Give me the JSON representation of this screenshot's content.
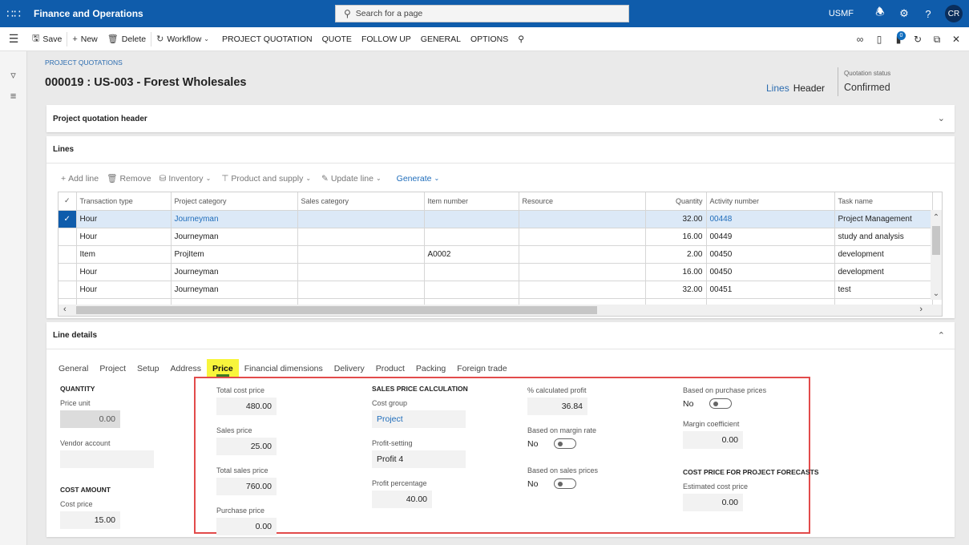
{
  "app": {
    "name": "Finance and Operations",
    "search_placeholder": "Search for a page",
    "company": "USMF",
    "user_initials": "CR",
    "notification_count": "0"
  },
  "actions": {
    "save": "Save",
    "new": "New",
    "delete": "Delete",
    "workflow": "Workflow",
    "menus": [
      "PROJECT QUOTATION",
      "QUOTE",
      "FOLLOW UP",
      "GENERAL",
      "OPTIONS"
    ]
  },
  "page": {
    "breadcrumb": "PROJECT QUOTATIONS",
    "title": "000019 : US-003 - Forest Wholesales",
    "view_lines": "Lines",
    "view_header": "Header",
    "status_label": "Quotation status",
    "status_value": "Confirmed"
  },
  "header_section": {
    "title": "Project quotation header"
  },
  "lines": {
    "title": "Lines",
    "toolbar": {
      "add_line": "Add line",
      "remove": "Remove",
      "inventory": "Inventory",
      "product_supply": "Product and supply",
      "update_line": "Update line",
      "generate": "Generate"
    },
    "columns": [
      "Transaction type",
      "Project category",
      "Sales category",
      "Item number",
      "Resource",
      "Quantity",
      "Activity number",
      "Task name"
    ],
    "rows": [
      {
        "selected": true,
        "transaction_type": "Hour",
        "project_category": "Journeyman",
        "sales_category": "",
        "item_number": "",
        "resource": "",
        "quantity": "32.00",
        "activity_number": "00448",
        "task_name": "Project Management"
      },
      {
        "selected": false,
        "transaction_type": "Hour",
        "project_category": "Journeyman",
        "sales_category": "",
        "item_number": "",
        "resource": "",
        "quantity": "16.00",
        "activity_number": "00449",
        "task_name": "study and analysis"
      },
      {
        "selected": false,
        "transaction_type": "Item",
        "project_category": "ProjItem",
        "sales_category": "",
        "item_number": "A0002",
        "resource": "",
        "quantity": "2.00",
        "activity_number": "00450",
        "task_name": "development"
      },
      {
        "selected": false,
        "transaction_type": "Hour",
        "project_category": "Journeyman",
        "sales_category": "",
        "item_number": "",
        "resource": "",
        "quantity": "16.00",
        "activity_number": "00450",
        "task_name": "development"
      },
      {
        "selected": false,
        "transaction_type": "Hour",
        "project_category": "Journeyman",
        "sales_category": "",
        "item_number": "",
        "resource": "",
        "quantity": "32.00",
        "activity_number": "00451",
        "task_name": "test"
      }
    ]
  },
  "line_details": {
    "title": "Line details",
    "tabs": [
      "General",
      "Project",
      "Setup",
      "Address",
      "Price",
      "Financial dimensions",
      "Delivery",
      "Product",
      "Packing",
      "Foreign trade"
    ],
    "active_tab": "Price",
    "quantity": {
      "section": "QUANTITY",
      "price_unit_label": "Price unit",
      "price_unit": "0.00",
      "vendor_account_label": "Vendor account",
      "vendor_account": ""
    },
    "cost_amount": {
      "section": "COST AMOUNT",
      "cost_price_label": "Cost price",
      "cost_price": "15.00"
    },
    "prices": {
      "total_cost_price_label": "Total cost price",
      "total_cost_price": "480.00",
      "sales_price_label": "Sales price",
      "sales_price": "25.00",
      "total_sales_price_label": "Total sales price",
      "total_sales_price": "760.00",
      "purchase_price_label": "Purchase price",
      "purchase_price": "0.00"
    },
    "sales_price_calc": {
      "section": "SALES PRICE CALCULATION",
      "cost_group_label": "Cost group",
      "cost_group": "Project",
      "profit_setting_label": "Profit-setting",
      "profit_setting": "Profit 4",
      "profit_percentage_label": "Profit percentage",
      "profit_percentage": "40.00"
    },
    "profit": {
      "calc_profit_label": "% calculated profit",
      "calc_profit": "36.84",
      "margin_rate_label": "Based on margin rate",
      "margin_rate": "No",
      "sales_prices_label": "Based on sales prices",
      "sales_prices": "No"
    },
    "purchase": {
      "purchase_prices_label": "Based on purchase prices",
      "purchase_prices": "No",
      "margin_coef_label": "Margin coefficient",
      "margin_coef": "0.00"
    },
    "forecast": {
      "section": "COST PRICE FOR PROJECT FORECASTS",
      "est_cost_label": "Estimated cost price",
      "est_cost": "0.00"
    }
  }
}
